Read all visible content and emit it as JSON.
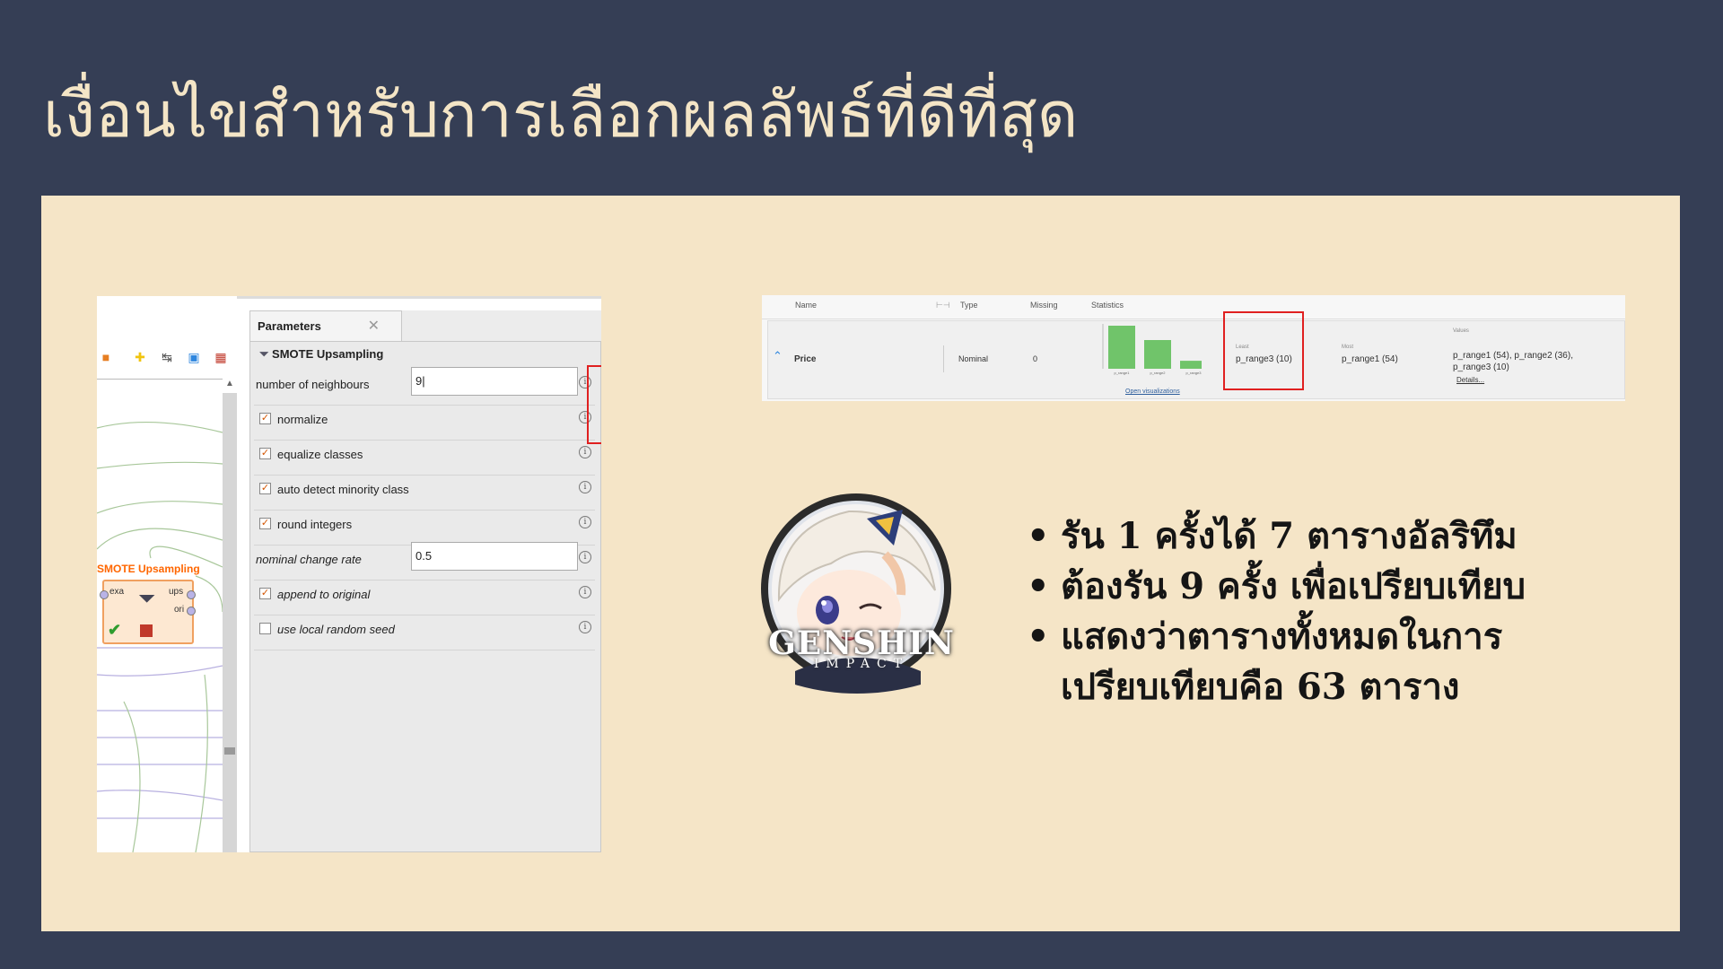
{
  "slide": {
    "title": "เงื่อนไขสำหรับการเลือกผลลัพธ์ที่ดีที่สุด"
  },
  "parameters_panel": {
    "tab_label": "Parameters",
    "tab_close": "✕",
    "operator_name": "SMOTE Upsampling",
    "rows": [
      {
        "label": "number of neighbours",
        "type": "text",
        "value": "9|"
      },
      {
        "label": "normalize",
        "type": "checkbox",
        "checked": true
      },
      {
        "label": "equalize classes",
        "type": "checkbox",
        "checked": true
      },
      {
        "label": "auto detect minority class",
        "type": "checkbox",
        "checked": true
      },
      {
        "label": "round integers",
        "type": "checkbox",
        "checked": true
      },
      {
        "label": "nominal change rate",
        "type": "text",
        "value": "0.5"
      },
      {
        "label": "append to original",
        "type": "checkbox",
        "checked": true
      },
      {
        "label": "use local random seed",
        "type": "checkbox",
        "checked": false
      }
    ],
    "info_glyph": "i",
    "check_glyph": "✓"
  },
  "process_view": {
    "operator_title": "SMOTE Upsampling",
    "port_exa": "exa",
    "port_ups": "ups",
    "port_ori": "ori",
    "toolbar_icons": [
      "folder-icon",
      "add-note-icon",
      "route-icon",
      "layers-icon",
      "grid-icon"
    ]
  },
  "statistics_panel": {
    "headers": {
      "name": "Name",
      "type": "Type",
      "missing": "Missing",
      "statistics": "Statistics"
    },
    "attribute": {
      "name": "Price",
      "type": "Nominal",
      "missing": "0",
      "least_label": "Least",
      "least_value": "p_range3 (10)",
      "most_label": "Most",
      "most_value": "p_range1 (54)",
      "values_label": "Values",
      "values_line1": "p_range1 (54), p_range2 (36),",
      "values_line2": "p_range3 (10)",
      "details_link": "Details...",
      "open_visualizations": "Open visualizations"
    },
    "histogram": {
      "categories": [
        "p_range1",
        "p_range2",
        "p_range3"
      ],
      "values": [
        54,
        36,
        10
      ],
      "color": "#70c46a"
    }
  },
  "avatar": {
    "logo_text": "GENSHIN",
    "logo_sub": "IMPACT"
  },
  "bullets": [
    "รัน 1 ครั้งได้ 7 ตารางอัลริทึม",
    "ต้องรัน 9 ครั้ง เพื่อเปรียบเทียบ",
    "แสดงว่าตารางทั้งหมดในการ",
    "เปรียบเทียบคือ 63 ตาราง"
  ],
  "bullet_glyph": "•",
  "colors": {
    "background": "#353e55",
    "panel": "#f5e5c7",
    "title": "#f4e5c6",
    "highlight": "#e02020",
    "operator_title": "#ff6600"
  }
}
